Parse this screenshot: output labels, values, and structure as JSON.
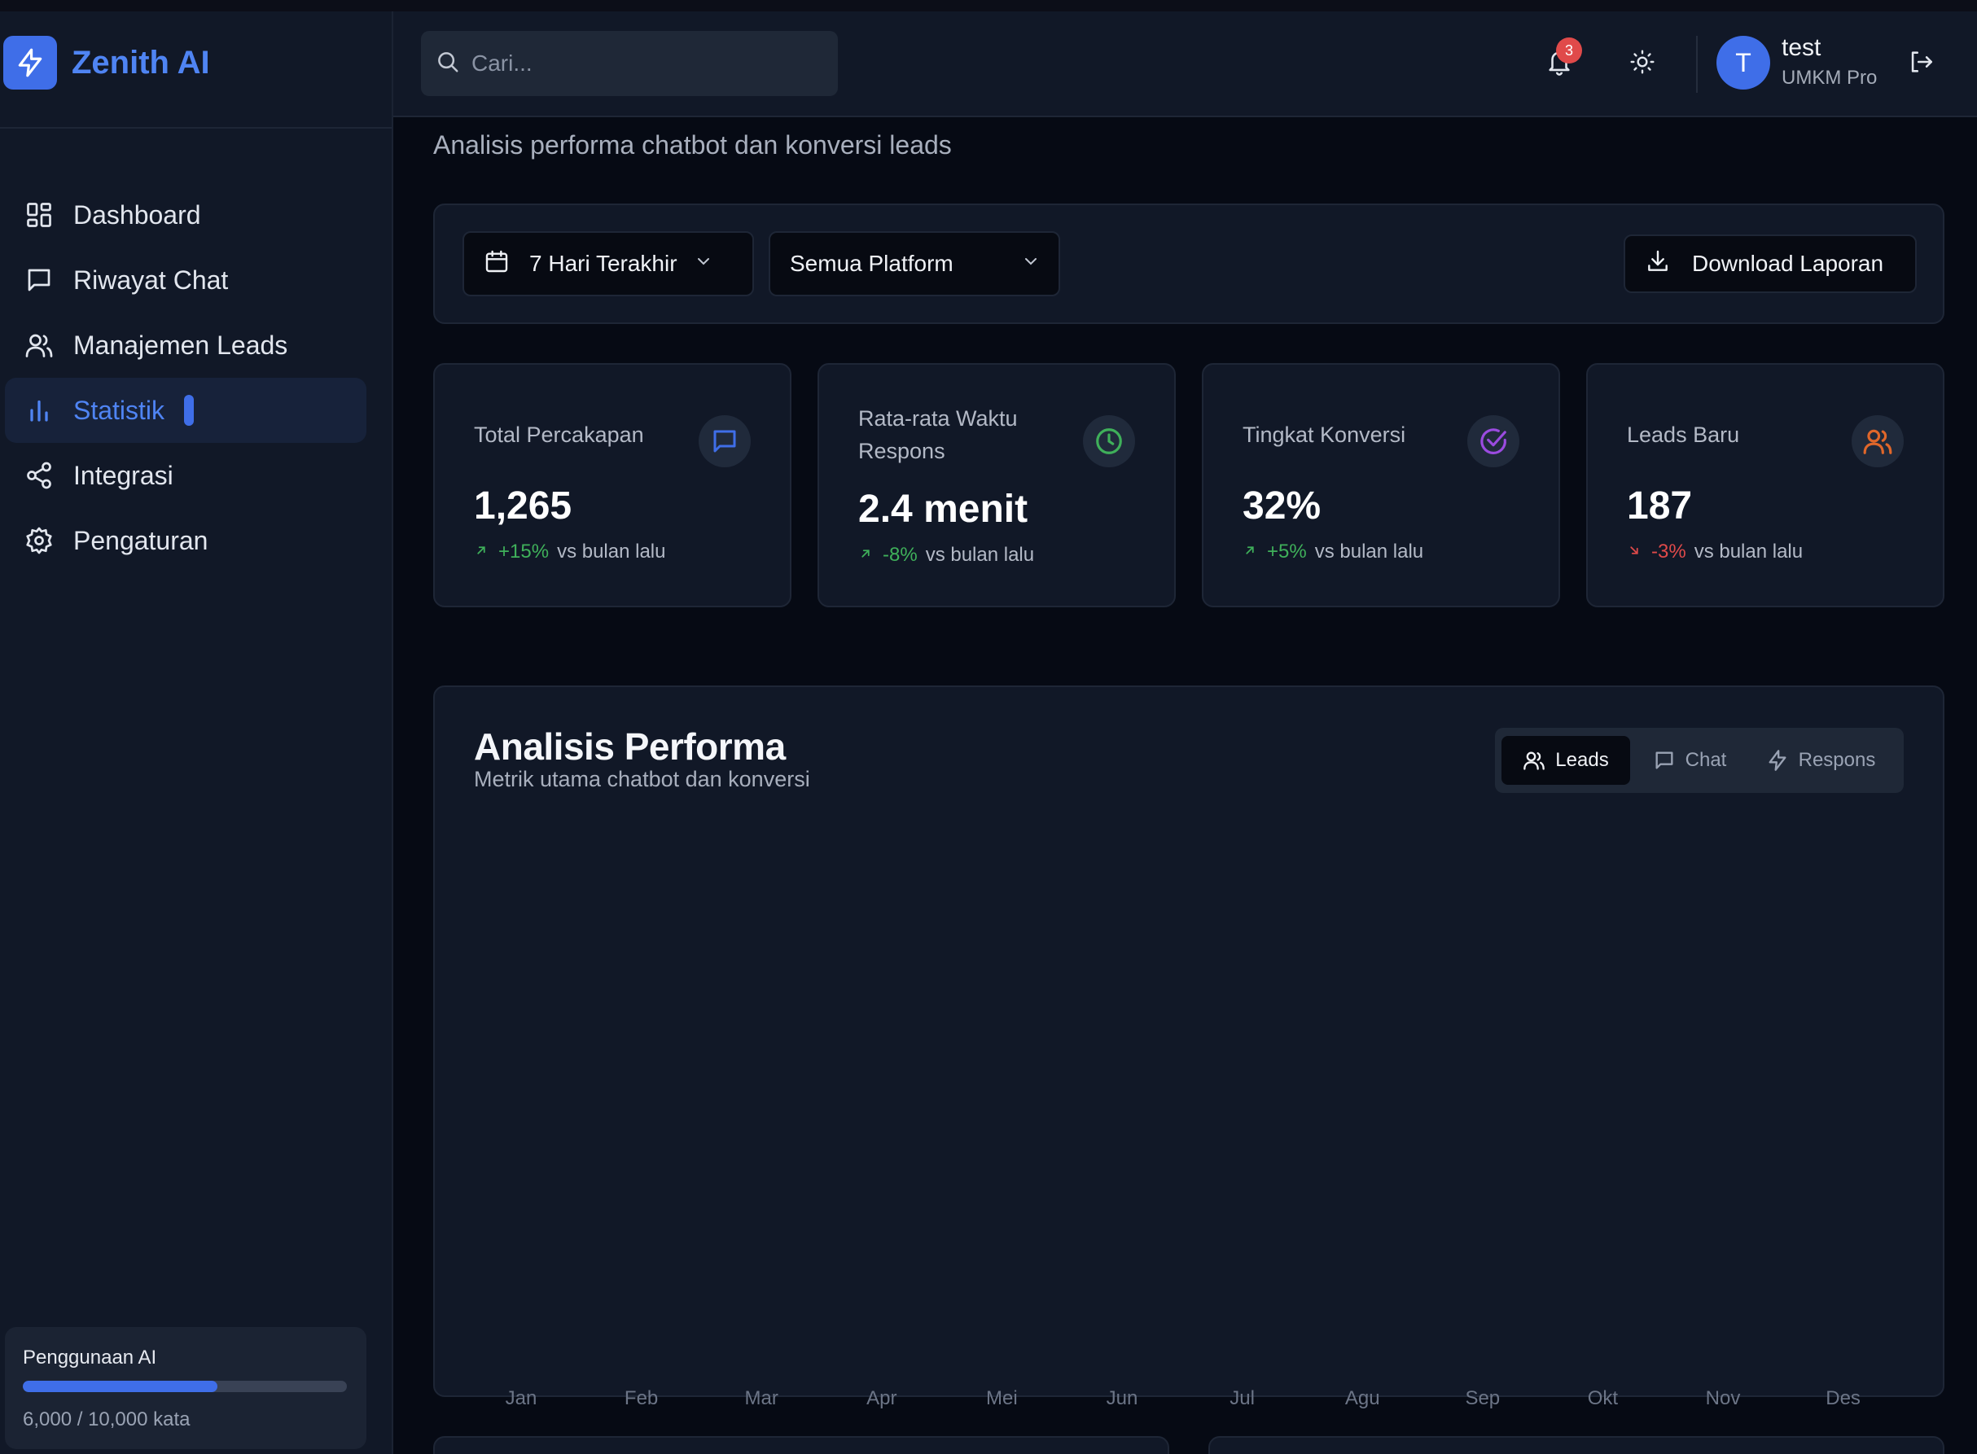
{
  "brand": {
    "name": "Zenith AI"
  },
  "sidebar": {
    "items": [
      {
        "label": "Dashboard",
        "icon": "dashboard-icon"
      },
      {
        "label": "Riwayat Chat",
        "icon": "chat-icon"
      },
      {
        "label": "Manajemen Leads",
        "icon": "users-icon"
      },
      {
        "label": "Statistik",
        "icon": "bar-chart-icon",
        "active": true
      },
      {
        "label": "Integrasi",
        "icon": "share-icon"
      },
      {
        "label": "Pengaturan",
        "icon": "gear-icon"
      }
    ],
    "usage": {
      "title": "Penggunaan AI",
      "text": "6,000 / 10,000 kata",
      "used": 6000,
      "limit": 10000
    }
  },
  "header": {
    "search_placeholder": "Cari...",
    "notification_count": "3",
    "user": {
      "initial": "T",
      "name": "test",
      "plan": "UMKM Pro"
    }
  },
  "page": {
    "subtitle": "Analisis performa chatbot dan konversi leads"
  },
  "filters": {
    "date_range": "7 Hari Terakhir",
    "platform": "Semua Platform",
    "download_label": "Download Laporan"
  },
  "stats": [
    {
      "title": "Total Percakapan",
      "value": "1,265",
      "change": "+15%",
      "suffix": "vs bulan lalu",
      "trend": "up",
      "icon": "message-icon",
      "color": "#3f6ee8"
    },
    {
      "title": "Rata-rata Waktu Respons",
      "value": "2.4 menit",
      "change": "-8%",
      "suffix": "vs bulan lalu",
      "trend": "up",
      "icon": "clock-icon",
      "color": "#3fb05a"
    },
    {
      "title": "Tingkat Konversi",
      "value": "32%",
      "change": "+5%",
      "suffix": "vs bulan lalu",
      "trend": "up",
      "icon": "check-circle-icon",
      "color": "#9b4be0"
    },
    {
      "title": "Leads Baru",
      "value": "187",
      "change": "-3%",
      "suffix": "vs bulan lalu",
      "trend": "down",
      "icon": "users-icon",
      "color": "#e0672a"
    }
  ],
  "colors": {
    "accent": "#3f6ee8",
    "positive": "#3fb05a",
    "negative": "#e04a4a"
  },
  "performance": {
    "title": "Analisis Performa",
    "subtitle": "Metrik utama chatbot dan konversi",
    "tabs": [
      "Leads",
      "Chat",
      "Respons"
    ],
    "active_tab": "Leads",
    "months": [
      "Jan",
      "Feb",
      "Mar",
      "Apr",
      "Mei",
      "Jun",
      "Jul",
      "Agu",
      "Sep",
      "Okt",
      "Nov",
      "Des"
    ]
  }
}
